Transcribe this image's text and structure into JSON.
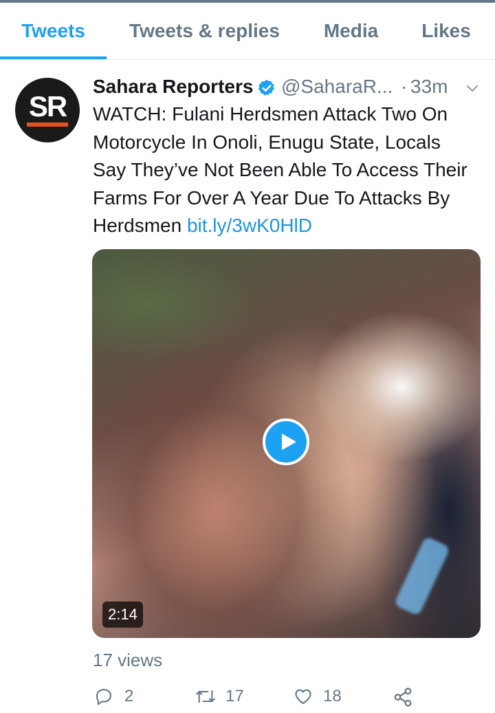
{
  "tabs": [
    {
      "label": "Tweets",
      "active": true
    },
    {
      "label": "Tweets & replies",
      "active": false
    },
    {
      "label": "Media",
      "active": false
    },
    {
      "label": "Likes",
      "active": false
    }
  ],
  "tweet": {
    "avatar_text": "SR",
    "author_name": "Sahara Reporters",
    "verified": true,
    "handle": "@SaharaR...",
    "separator": "·",
    "time": "33m",
    "text": "WATCH: Fulani Herdsmen Attack Two On Motorcycle In Onoli, Enugu State, Locals Say They’ve Not Been Able To Access Their Farms For Over A Year Due To Attacks By Herdsmen ",
    "link": "bit.ly/3wK0HlD",
    "video_duration": "2:14",
    "views": "17 views",
    "replies": "2",
    "retweets": "17",
    "likes": "18"
  },
  "colors": {
    "accent": "#1da1f2",
    "link": "#1b95e0",
    "muted": "#657786",
    "avatar_bar": "#e8521f"
  },
  "icons": [
    "verified-badge-icon",
    "chevron-down-icon",
    "play-icon",
    "reply-icon",
    "retweet-icon",
    "like-icon",
    "share-icon"
  ]
}
